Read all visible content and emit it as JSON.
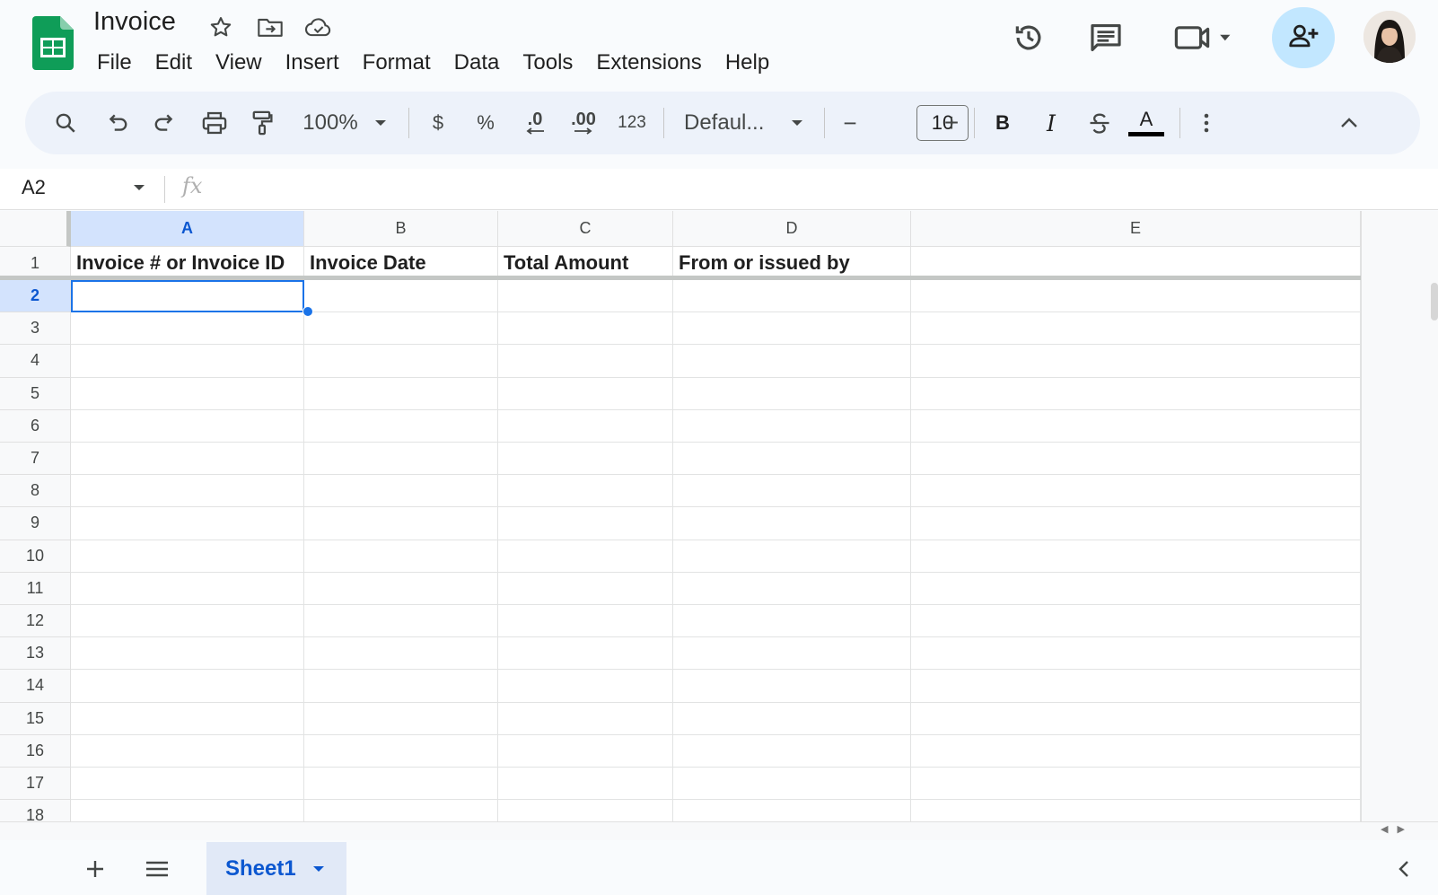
{
  "doc": {
    "title": "Invoice"
  },
  "menu": [
    "File",
    "Edit",
    "View",
    "Insert",
    "Format",
    "Data",
    "Tools",
    "Extensions",
    "Help"
  ],
  "toolbar": {
    "zoom": "100%",
    "currency": "$",
    "percent": "%",
    "decrease_decimal": ".0",
    "increase_decimal": ".00",
    "number_format": "123",
    "font": "Defaul...",
    "font_size": "10",
    "minus": "−",
    "plus": "+",
    "bold": "B",
    "italic": "I",
    "text_color_letter": "A"
  },
  "formula_bar": {
    "name_box": "A2",
    "fx": "fx",
    "value": ""
  },
  "columns": [
    "A",
    "B",
    "C",
    "D",
    "E"
  ],
  "rows": [
    "1",
    "2",
    "3",
    "4",
    "5",
    "6",
    "7",
    "8",
    "9",
    "10",
    "11",
    "12",
    "13",
    "14",
    "15",
    "16",
    "17",
    "18"
  ],
  "header_row": [
    "Invoice # or Invoice ID",
    "Invoice Date",
    "Total Amount",
    "From or issued by",
    ""
  ],
  "selection": {
    "cell": "A2",
    "column": "A",
    "row": "2"
  },
  "sheets": [
    {
      "name": "Sheet1",
      "active": true
    }
  ],
  "colors": {
    "accent": "#1a73e8",
    "share_bg": "#c2e7ff",
    "toolbar_bg": "#edf2fa",
    "sheets_green": "#0f9d58",
    "selected_header": "#d3e3fd"
  },
  "icons": [
    "sheets-logo-icon",
    "star-icon",
    "move-folder-icon",
    "cloud-saved-icon",
    "version-history-icon",
    "comments-icon",
    "meet-icon",
    "share-person-icon",
    "search-icon",
    "undo-icon",
    "redo-icon",
    "print-icon",
    "paint-format-icon",
    "strikethrough-icon",
    "more-vert-icon",
    "collapse-up-icon",
    "add-sheet-icon",
    "all-sheets-icon",
    "side-panel-toggle-icon"
  ]
}
